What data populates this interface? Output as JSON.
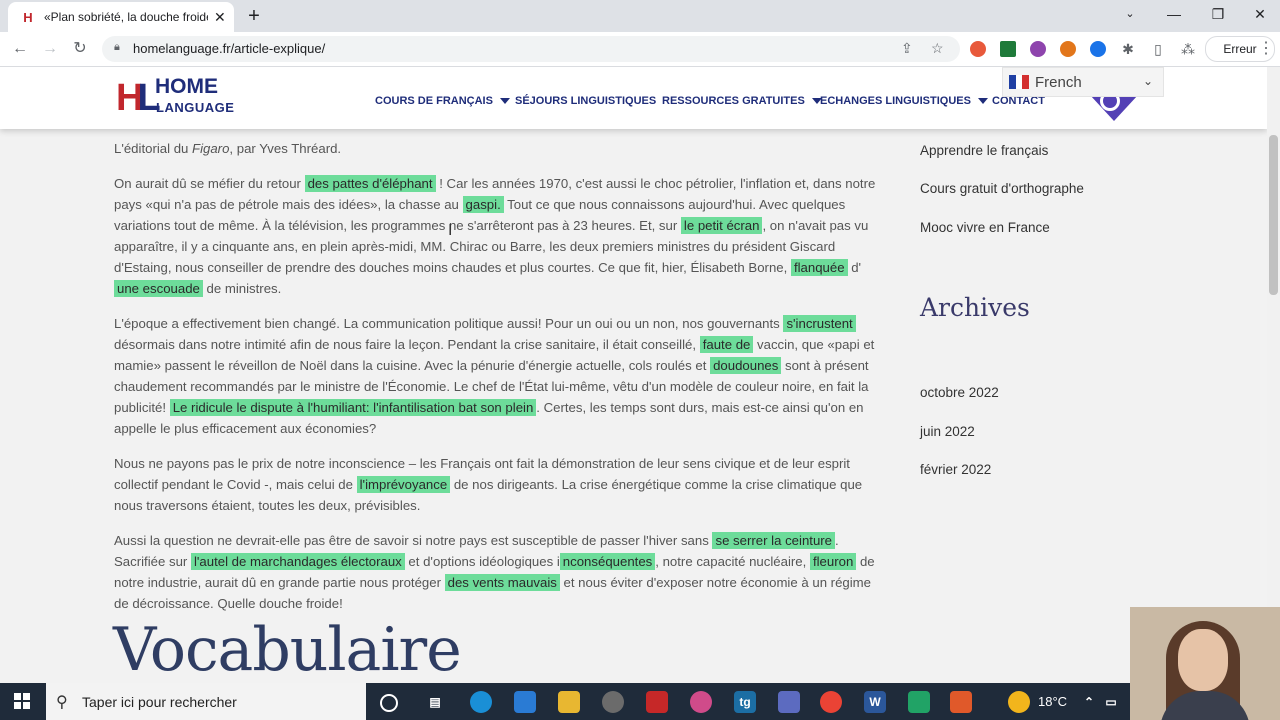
{
  "browser": {
    "tab_title": "«Plan sobriété, la douche froide»",
    "tab_favicon": "H",
    "url": "homelanguage.fr/article-explique/",
    "error_button": "Erreur"
  },
  "site": {
    "logo_mark": "H",
    "logo_mark2": "L",
    "logo_home": "HOME",
    "logo_language": "LANGUAGE",
    "nav": [
      "COURS DE FRANÇAIS",
      "SÉJOURS LINGUISTIQUES",
      "RESSOURCES GRATUITES",
      "ECHANGES LINGUISTIQUES",
      "CONTACT"
    ],
    "translate_label": "French"
  },
  "article": {
    "intro_a": "L'éditorial du ",
    "intro_b": "Figaro",
    "intro_c": ", par Yves Thréard.",
    "p1": {
      "t1": "On aurait dû se méfier du retour ",
      "h1": "des pattes d'éléphant",
      "t2": " ! Car les années 1970, c'est aussi le choc pétrolier, l'inflation et, dans notre pays «qui n'a pas de pétrole mais des idées», la chasse au ",
      "h2": "gaspi.",
      "t3": " Tout ce que nous connaissons aujourd'hui. Avec quelques variations tout de même. À la télévision, les programmes ne s'arrêteront pas à 23 heures. Et, sur ",
      "h3": "le petit écran",
      "t4": ", on n'avait pas vu apparaître, il y a cinquante ans, en plein après-midi, MM. Chirac ou Barre, les deux premiers ministres du président Giscard d'Estaing, nous conseiller de prendre des douches moins chaudes et plus courtes. Ce que fit, hier, Élisabeth Borne, ",
      "h4": "flanquée",
      "t5": " d' ",
      "h5": "une escouade",
      "t6": " de ministres."
    },
    "p2": {
      "t1": "L'époque a effectivement bien changé. La communication politique aussi! Pour un oui ou un non, nos gouvernants ",
      "h1": "s'incrustent",
      "t2": " désormais dans notre intimité afin de nous faire la leçon. Pendant la crise sanitaire, il était conseillé, ",
      "h2": "faute de",
      "t3": " vaccin, que «papi et mamie» passent le réveillon de Noël dans la cuisine. Avec la pénurie d'énergie actuelle, cols roulés et ",
      "h3": "doudounes",
      "t4": " sont à présent chaudement recommandés par le ministre de l'Économie. Le chef de l'État lui-même, vêtu d'un modèle de couleur noire, en fait la publicité! ",
      "h4": "Le ridicule le dispute à l'humiliant: l'infantilisation bat son plein",
      "t5": ". Certes, les temps sont durs, mais est-ce ainsi qu'on en appelle le plus efficacement aux économies?"
    },
    "p3": {
      "t1": "Nous ne payons pas le prix de notre inconscience – les Français ont fait la démonstration de leur sens civique et de leur esprit collectif pendant le Covid -, mais celui de ",
      "h1": "l'imprévoyance",
      "t2": " de nos dirigeants. La crise énergétique comme la crise climatique que nous traversons étaient, toutes les deux, prévisibles."
    },
    "p4": {
      "t1": "Aussi la question ne devrait-elle pas être de savoir si notre pays est susceptible de passer l'hiver sans ",
      "h1": "se serrer la ceinture",
      "t2": ". Sacrifiée sur ",
      "h2": "l'autel de marchandages électoraux",
      "t3": " et d'options idéologiques i",
      "h3": "nconséquentes",
      "t4": ", notre capacité nucléaire, ",
      "h4": "fleuron",
      "t5": " de notre industrie, aurait dû en grande partie nous protéger ",
      "h5": "des vents mauvais",
      "t6": " et nous éviter d'exposer notre économie à un régime de décroissance. Quelle douche froide!"
    },
    "heading": "Vocabulaire"
  },
  "sidebar": {
    "links": [
      "Apprendre le français",
      "Cours gratuit d'orthographe",
      "Mooc vivre en France"
    ],
    "archives_title": "Archives",
    "archives": [
      "octobre 2022",
      "juin 2022",
      "février 2022"
    ]
  },
  "taskbar": {
    "search_placeholder": "Taper ici pour rechercher",
    "temperature": "18°C"
  },
  "colors": {
    "highlight": "#6ddc9a",
    "brand_blue": "#1f2d7a",
    "brand_red": "#c1272d"
  }
}
